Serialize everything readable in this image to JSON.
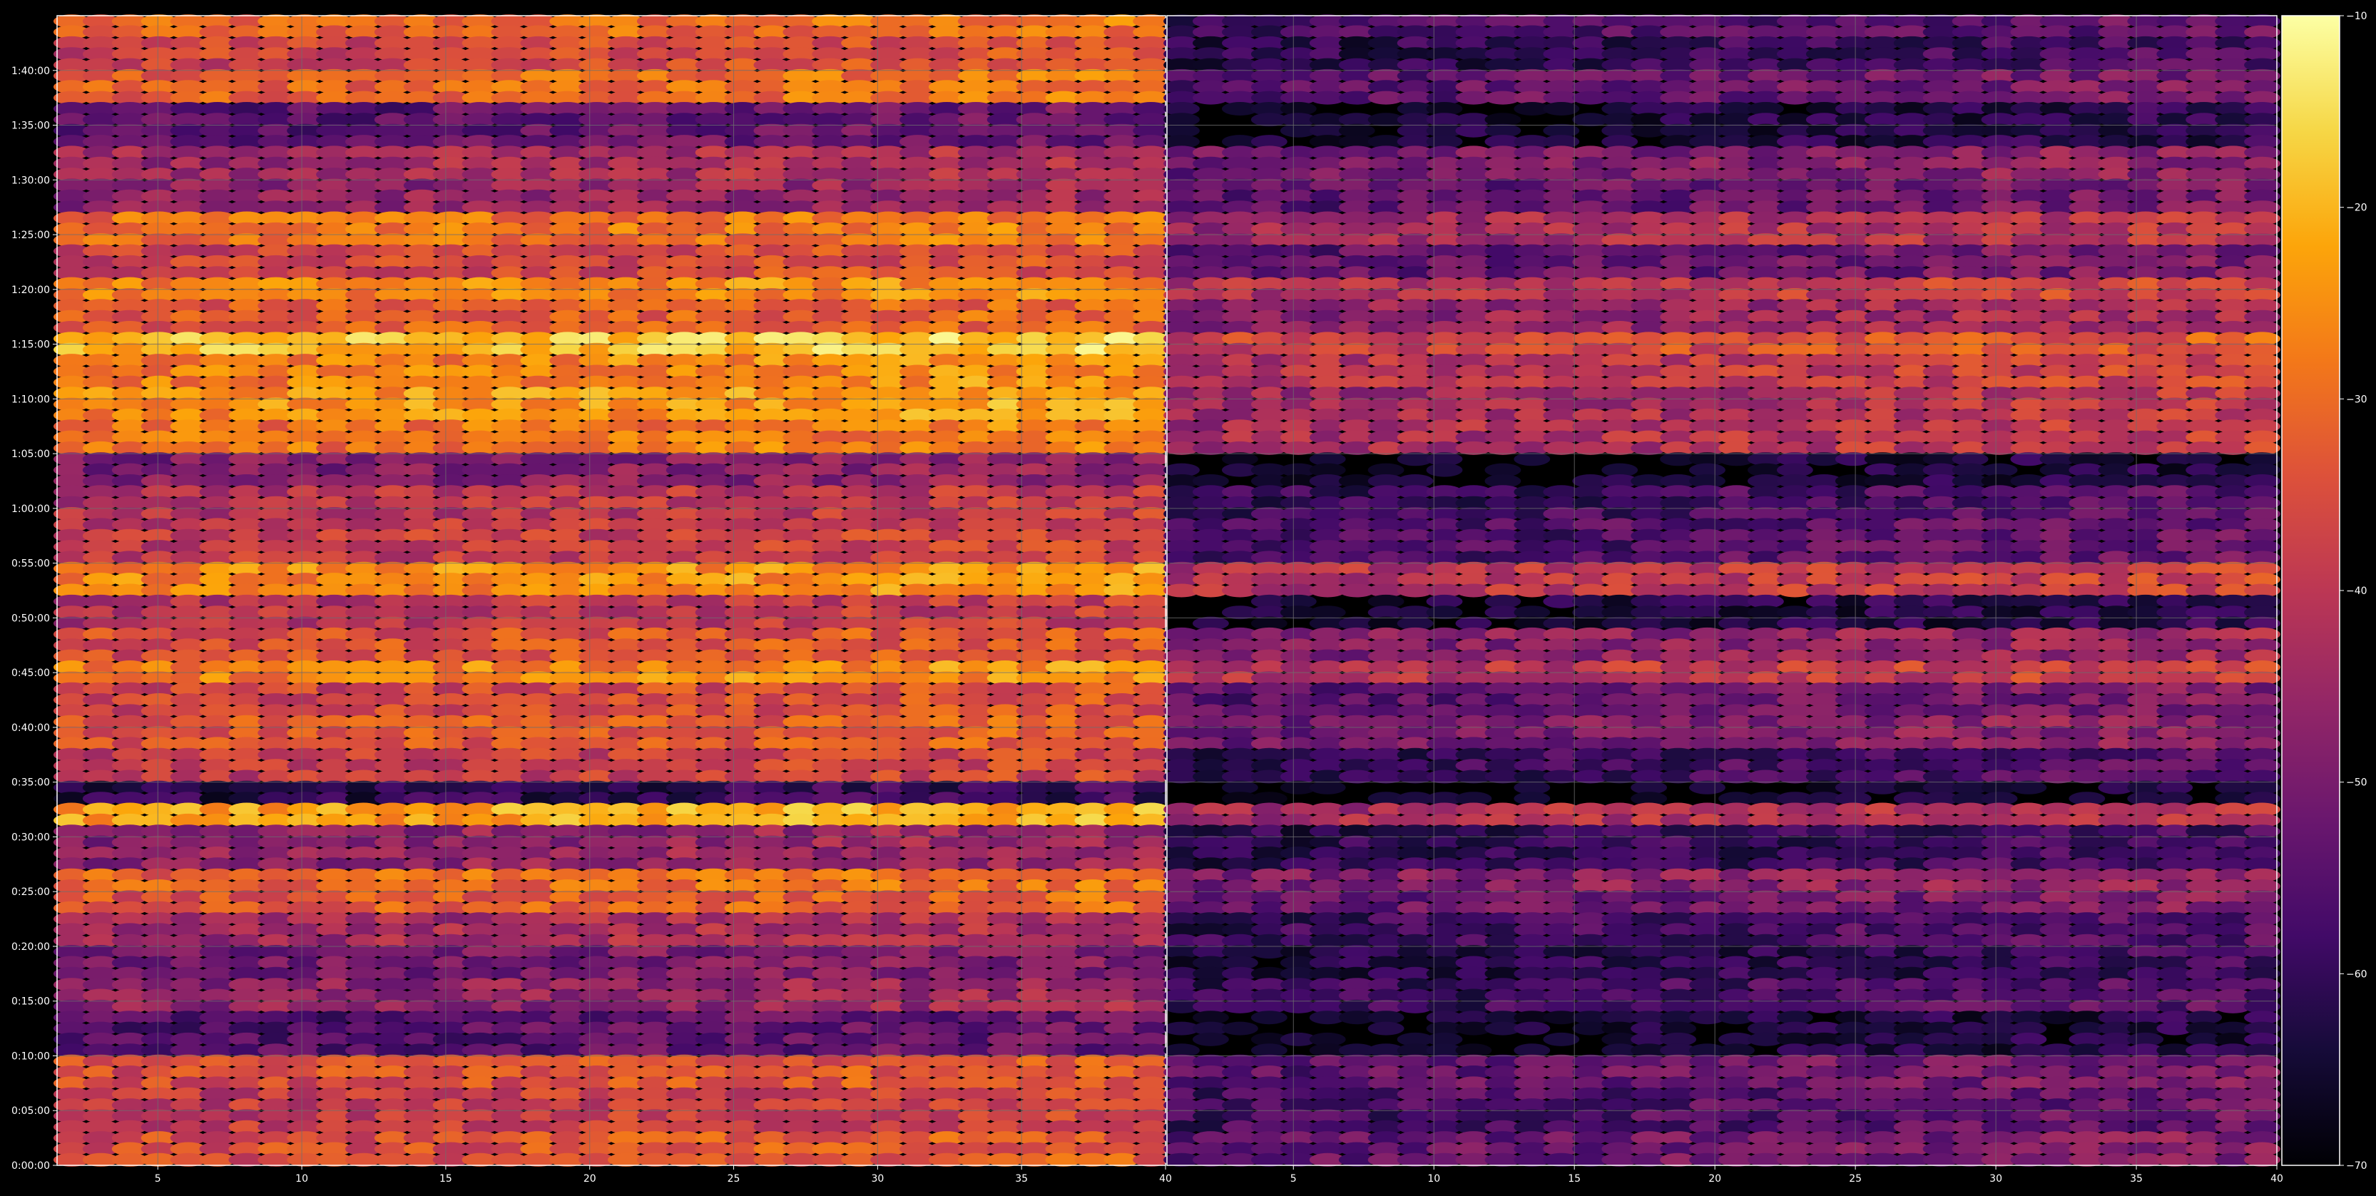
{
  "colors": {
    "background": "#000000",
    "axis_frame": "#ffffff",
    "grid": "#6e6e6e",
    "tick_text": "#ffffff",
    "colormap": "inferno"
  },
  "chart_data": {
    "type": "heatmap",
    "title": "",
    "xlabel": "",
    "ylabel": "",
    "grid": true,
    "colormap": "inferno",
    "value_range": [
      -70,
      -10
    ],
    "y_range_seconds": [
      0,
      6300
    ],
    "y_tick_labels": [
      "0:00:00",
      "0:05:00",
      "0:10:00",
      "0:15:00",
      "0:20:00",
      "0:25:00",
      "0:30:00",
      "0:35:00",
      "0:40:00",
      "0:45:00",
      "0:50:00",
      "0:55:00",
      "1:00:00",
      "1:05:00",
      "1:10:00",
      "1:15:00",
      "1:20:00",
      "1:25:00",
      "1:30:00",
      "1:35:00",
      "1:40:00"
    ],
    "y_tick_seconds": [
      0,
      300,
      600,
      900,
      1200,
      1500,
      1800,
      2100,
      2400,
      2700,
      3000,
      3300,
      3600,
      3900,
      4200,
      4500,
      4800,
      5100,
      5400,
      5700,
      6000
    ],
    "panels": [
      {
        "name": "",
        "x_range": [
          1.5,
          40
        ],
        "x_ticks": [
          5,
          10,
          15,
          20,
          25,
          30,
          35,
          40
        ],
        "x_tick_labels": [
          "5",
          "10",
          "15",
          "20",
          "25",
          "30",
          "35",
          "40"
        ]
      },
      {
        "name": "",
        "x_range": [
          0.5,
          40
        ],
        "x_ticks": [
          5,
          10,
          15,
          20,
          25,
          30,
          35,
          40
        ],
        "x_tick_labels": [
          "5",
          "10",
          "15",
          "20",
          "25",
          "30",
          "35",
          "40"
        ]
      }
    ],
    "colorbar": {
      "ticks": [
        -10,
        -20,
        -30,
        -40,
        -50,
        -60,
        -70
      ],
      "tick_labels": [
        "−10",
        "−20",
        "−30",
        "−40",
        "−50",
        "−60",
        "−70"
      ],
      "range": [
        -70,
        -10
      ]
    },
    "row_profile": {
      "unit": "dB",
      "description_of_values": "Approximate mean level per time band in each panel (tracks read across the full width).",
      "bands": [
        {
          "t_start": 6180,
          "t_end": 6300,
          "left": -32,
          "right": -58
        },
        {
          "t_start": 6000,
          "t_end": 6180,
          "left": -38,
          "right": -62
        },
        {
          "t_start": 5820,
          "t_end": 6000,
          "left": -32,
          "right": -55
        },
        {
          "t_start": 5580,
          "t_end": 5820,
          "left": -55,
          "right": -66
        },
        {
          "t_start": 5400,
          "t_end": 5580,
          "left": -45,
          "right": -52
        },
        {
          "t_start": 5220,
          "t_end": 5400,
          "left": -48,
          "right": -55
        },
        {
          "t_start": 5040,
          "t_end": 5220,
          "left": -30,
          "right": -45
        },
        {
          "t_start": 4860,
          "t_end": 5040,
          "left": -38,
          "right": -55
        },
        {
          "t_start": 4740,
          "t_end": 4860,
          "left": -28,
          "right": -42
        },
        {
          "t_start": 4560,
          "t_end": 4740,
          "left": -34,
          "right": -48
        },
        {
          "t_start": 4440,
          "t_end": 4560,
          "left": -20,
          "right": -38
        },
        {
          "t_start": 4260,
          "t_end": 4440,
          "left": -28,
          "right": -42
        },
        {
          "t_start": 4080,
          "t_end": 4260,
          "left": -26,
          "right": -45
        },
        {
          "t_start": 3900,
          "t_end": 4080,
          "left": -30,
          "right": -44
        },
        {
          "t_start": 3720,
          "t_end": 3900,
          "left": -50,
          "right": -68
        },
        {
          "t_start": 3540,
          "t_end": 3720,
          "left": -42,
          "right": -60
        },
        {
          "t_start": 3300,
          "t_end": 3540,
          "left": -40,
          "right": -58
        },
        {
          "t_start": 3120,
          "t_end": 3300,
          "left": -27,
          "right": -42
        },
        {
          "t_start": 2940,
          "t_end": 3120,
          "left": -42,
          "right": -66
        },
        {
          "t_start": 2760,
          "t_end": 2940,
          "left": -36,
          "right": -50
        },
        {
          "t_start": 2640,
          "t_end": 2760,
          "left": -28,
          "right": -42
        },
        {
          "t_start": 2460,
          "t_end": 2640,
          "left": -38,
          "right": -55
        },
        {
          "t_start": 2280,
          "t_end": 2460,
          "left": -35,
          "right": -52
        },
        {
          "t_start": 2100,
          "t_end": 2280,
          "left": -40,
          "right": -60
        },
        {
          "t_start": 1980,
          "t_end": 2100,
          "left": -62,
          "right": -70
        },
        {
          "t_start": 1860,
          "t_end": 1980,
          "left": -24,
          "right": -44
        },
        {
          "t_start": 1620,
          "t_end": 1860,
          "left": -48,
          "right": -62
        },
        {
          "t_start": 1500,
          "t_end": 1620,
          "left": -32,
          "right": -50
        },
        {
          "t_start": 1380,
          "t_end": 1500,
          "left": -34,
          "right": -54
        },
        {
          "t_start": 1200,
          "t_end": 1380,
          "left": -45,
          "right": -60
        },
        {
          "t_start": 1020,
          "t_end": 1200,
          "left": -52,
          "right": -64
        },
        {
          "t_start": 840,
          "t_end": 1020,
          "left": -48,
          "right": -60
        },
        {
          "t_start": 600,
          "t_end": 840,
          "left": -56,
          "right": -68
        },
        {
          "t_start": 420,
          "t_end": 600,
          "left": -36,
          "right": -55
        },
        {
          "t_start": 180,
          "t_end": 420,
          "left": -40,
          "right": -58
        },
        {
          "t_start": 0,
          "t_end": 180,
          "left": -36,
          "right": -54
        }
      ]
    }
  }
}
